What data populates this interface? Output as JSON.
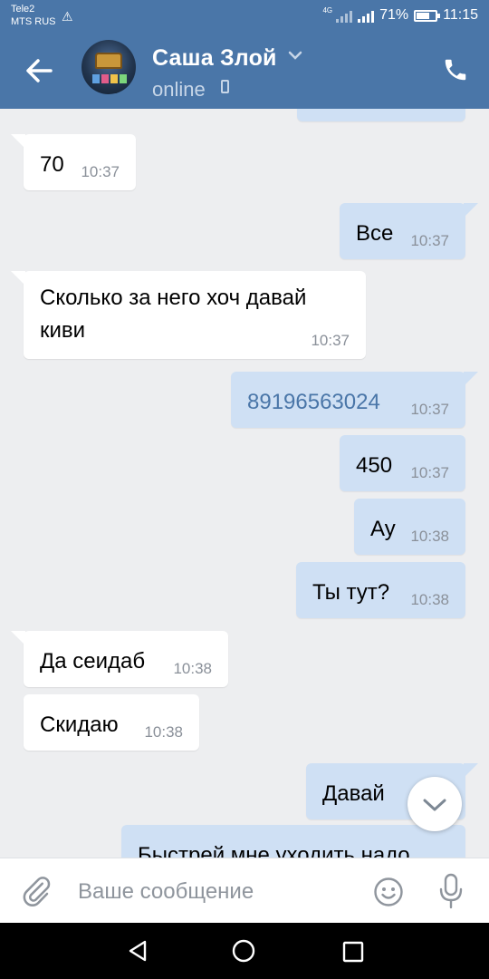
{
  "status_bar": {
    "carrier_1": "Tele2",
    "carrier_2": "MTS RUS",
    "network": "4G",
    "battery_percent": "71%",
    "battery_level": 0.71,
    "time": "11:15"
  },
  "header": {
    "contact_name": "Саша Злой",
    "presence": "online",
    "icons": [
      "back-arrow-icon",
      "chevron-down-icon",
      "mobile-phone-icon",
      "call-icon"
    ]
  },
  "messages": [
    {
      "dir": "in",
      "text": "70",
      "time": "10:37"
    },
    {
      "dir": "out",
      "text": "Все",
      "time": "10:37"
    },
    {
      "dir": "in",
      "text": "Сколько за него хоч давай киви",
      "line1": "Сколько за него хоч давай",
      "line2": "киви",
      "time": "10:37"
    },
    {
      "dir": "out",
      "text": "89196563024",
      "time": "10:37"
    },
    {
      "dir": "out",
      "text": "450",
      "time": "10:37"
    },
    {
      "dir": "out",
      "text": "Ау",
      "time": "10:38"
    },
    {
      "dir": "out",
      "text": "Ты тут?",
      "time": "10:38"
    },
    {
      "dir": "in",
      "text": "Да сеидаб",
      "time": "10:38"
    },
    {
      "dir": "in",
      "text": "Скидаю",
      "time": "10:38"
    },
    {
      "dir": "out",
      "text": "Давай",
      "time": ""
    },
    {
      "dir": "out",
      "text": "Быстрей мне уходить надо",
      "time": ""
    }
  ],
  "composer": {
    "placeholder": "Ваше сообщение",
    "icons": [
      "paperclip-icon",
      "smiley-icon",
      "microphone-icon"
    ]
  },
  "colors": {
    "header": "#4a76a8",
    "background": "#edeef0",
    "incoming_bubble": "#ffffff",
    "outgoing_bubble": "#cfe0f4",
    "link": "#4a76a8"
  }
}
